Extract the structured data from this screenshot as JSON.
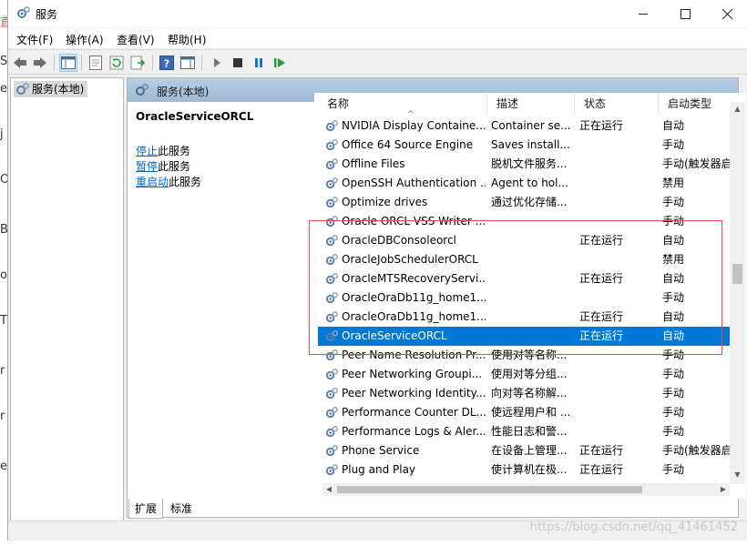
{
  "window": {
    "title": "服务"
  },
  "titlebar_buttons": {
    "minimize": "—",
    "maximize": "☐",
    "close": "✕"
  },
  "menu": [
    "文件(F)",
    "操作(A)",
    "查看(V)",
    "帮助(H)"
  ],
  "tree": {
    "item": "服务(本地)"
  },
  "content_header": {
    "label": "服务(本地)"
  },
  "detail": {
    "service_name": "OracleServiceORCL",
    "actions": [
      {
        "link": "停止",
        "suffix": "此服务"
      },
      {
        "link": "暂停",
        "suffix": "此服务"
      },
      {
        "link": "重启动",
        "suffix": "此服务"
      }
    ]
  },
  "columns": {
    "name": "名称",
    "desc": "描述",
    "status": "状态",
    "start": "启动类型"
  },
  "rows": [
    {
      "name": "NVIDIA Display Containe...",
      "desc": "Container se...",
      "status": "正在运行",
      "start": "自动"
    },
    {
      "name": "Office 64 Source Engine",
      "desc": "Saves install...",
      "status": "",
      "start": "手动"
    },
    {
      "name": "Offline Files",
      "desc": "脱机文件服务...",
      "status": "",
      "start": "手动(触发器启"
    },
    {
      "name": "OpenSSH Authentication ...",
      "desc": "Agent to hol...",
      "status": "",
      "start": "禁用"
    },
    {
      "name": "Optimize drives",
      "desc": "通过优化存储...",
      "status": "",
      "start": "手动"
    },
    {
      "name": "Oracle ORCL VSS Writer ...",
      "desc": "",
      "status": "",
      "start": "手动"
    },
    {
      "name": "OracleDBConsoleorcl",
      "desc": "",
      "status": "正在运行",
      "start": "自动"
    },
    {
      "name": "OracleJobSchedulerORCL",
      "desc": "",
      "status": "",
      "start": "禁用"
    },
    {
      "name": "OracleMTSRecoveryServi...",
      "desc": "",
      "status": "正在运行",
      "start": "自动"
    },
    {
      "name": "OracleOraDb11g_home1...",
      "desc": "",
      "status": "",
      "start": "手动"
    },
    {
      "name": "OracleOraDb11g_home1...",
      "desc": "",
      "status": "正在运行",
      "start": "自动"
    },
    {
      "name": "OracleServiceORCL",
      "desc": "",
      "status": "正在运行",
      "start": "自动",
      "selected": true
    },
    {
      "name": "Peer Name Resolution Pr...",
      "desc": "使用对等名称...",
      "status": "",
      "start": "手动"
    },
    {
      "name": "Peer Networking Groupi...",
      "desc": "使用对等分组...",
      "status": "",
      "start": "手动"
    },
    {
      "name": "Peer Networking Identity...",
      "desc": "向对等名称解...",
      "status": "",
      "start": "手动"
    },
    {
      "name": "Performance Counter DL...",
      "desc": "使远程用户和 ...",
      "status": "",
      "start": "手动"
    },
    {
      "name": "Performance Logs & Aler...",
      "desc": "性能日志和警...",
      "status": "",
      "start": "手动"
    },
    {
      "name": "Phone Service",
      "desc": "在设备上管理...",
      "status": "正在运行",
      "start": "手动(触发器启"
    },
    {
      "name": "Plug and Play",
      "desc": "使计算机在极...",
      "status": "正在运行",
      "start": "手动"
    }
  ],
  "tabs": [
    "扩展",
    "标准"
  ],
  "watermark": "https://blog.csdn.net/qq_41461452",
  "colors": {
    "selection": "#0078d7",
    "link": "#0066cc",
    "highlight_box": "#e8484e"
  }
}
